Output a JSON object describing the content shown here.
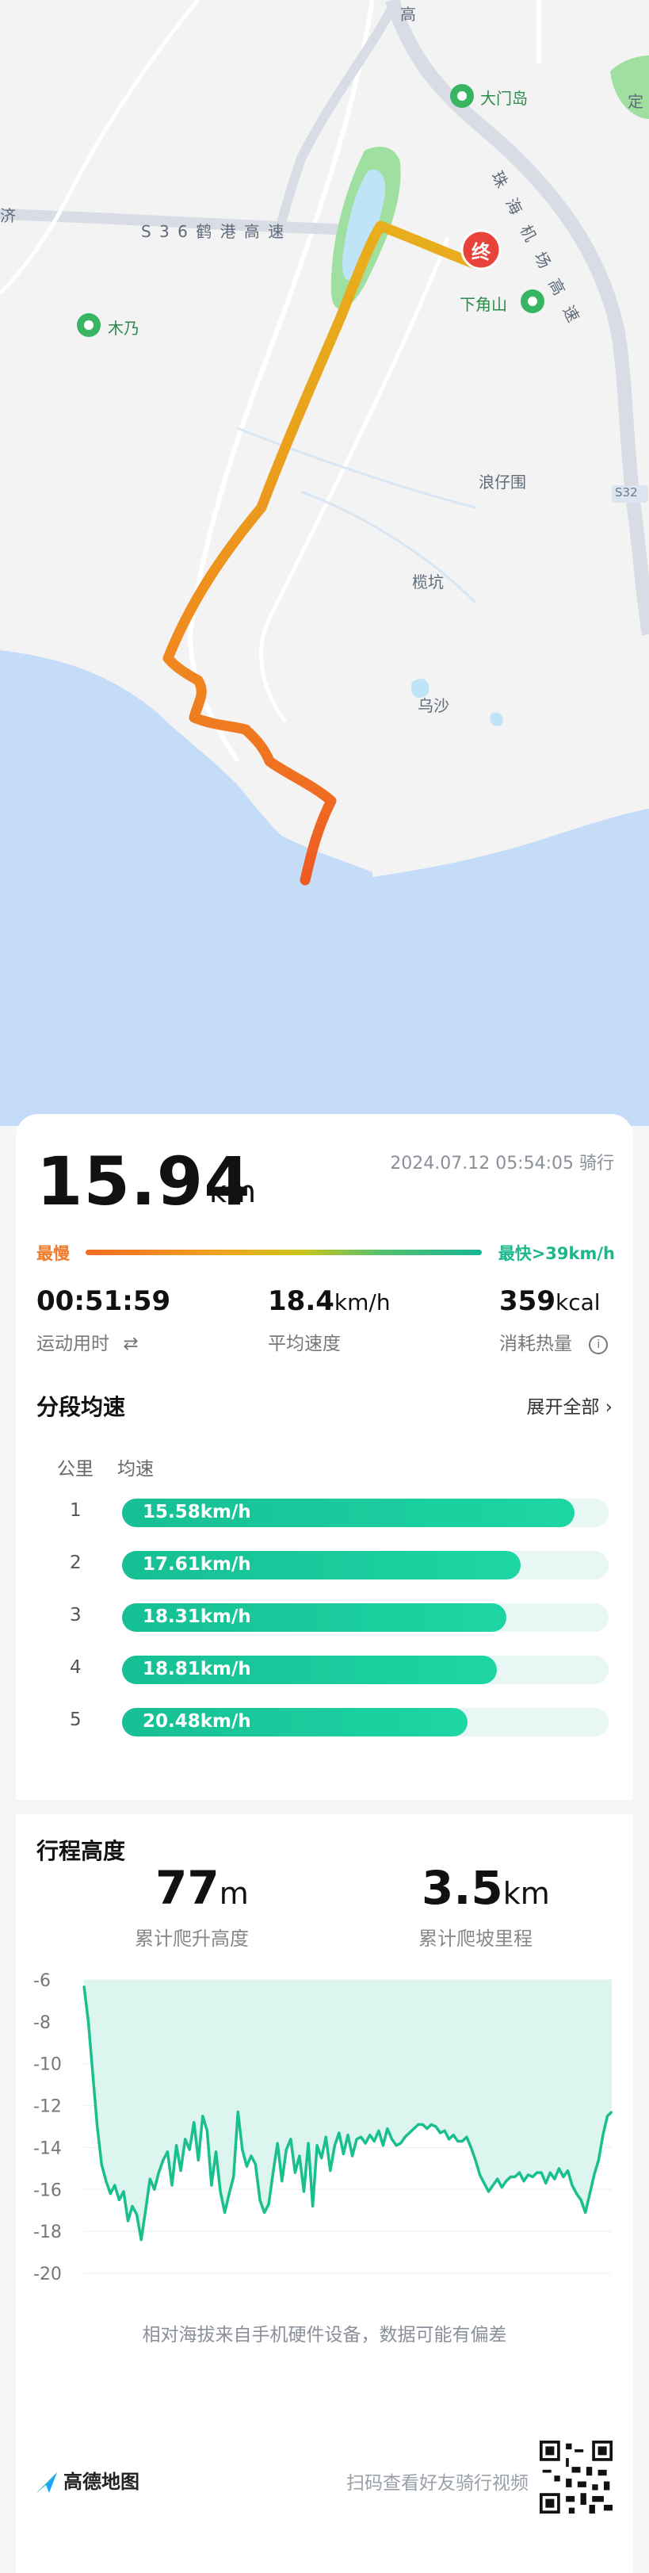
{
  "map": {
    "labels": {
      "damen_island": "大门岛",
      "ding": "定",
      "expressway_s36": "S 3 6 鹤 港 高 速",
      "airport_expressway": "珠 海 机 场 高 速",
      "gao": "高",
      "ji": "济",
      "munai": "木乃",
      "xiajiaoshan": "下角山",
      "langzaiwei": "浪仔围",
      "lankeng": "榄坑",
      "wusha": "乌沙",
      "road_code": "S32"
    },
    "end_marker": "终"
  },
  "summary": {
    "distance": "15.94",
    "distance_unit": "km",
    "datetime_activity": "2024.07.12 05:54:05 骑行",
    "slowest_label": "最慢",
    "fastest_label": "最快>39km/h"
  },
  "stats": {
    "duration": {
      "value": "00:51:59",
      "label": "运动用时"
    },
    "avg_speed": {
      "value": "18.4",
      "unit": "km/h",
      "label": "平均速度"
    },
    "calories": {
      "value": "359",
      "unit": "kcal",
      "label": "消耗热量"
    }
  },
  "segments": {
    "title": "分段均速",
    "expand_label": "展开全部",
    "col_km": "公里",
    "col_speed": "均速",
    "rows": [
      {
        "km": "1",
        "speed": "15.58km/h",
        "ratio": 0.93
      },
      {
        "km": "2",
        "speed": "17.61km/h",
        "ratio": 0.82
      },
      {
        "km": "3",
        "speed": "18.31km/h",
        "ratio": 0.79
      },
      {
        "km": "4",
        "speed": "18.81km/h",
        "ratio": 0.77
      },
      {
        "km": "5",
        "speed": "20.48km/h",
        "ratio": 0.71
      }
    ]
  },
  "elevation": {
    "title": "行程高度",
    "climb_value": "77",
    "climb_unit": "m",
    "climb_label": "累计爬升高度",
    "climb_dist_value": "3.5",
    "climb_dist_unit": "km",
    "climb_dist_label": "累计爬坡里程",
    "note": "相对海拔来自手机硬件设备，数据可能有偏差"
  },
  "chart_data": {
    "type": "area",
    "xlabel": "",
    "ylabel": "",
    "ylim": [
      -20,
      -6
    ],
    "yticks": [
      "-6",
      "-8",
      "-10",
      "-12",
      "-14",
      "-16",
      "-18",
      "-20"
    ],
    "series": [
      {
        "values": [
          -6.3,
          -8,
          -10.5,
          -13,
          -14.8,
          -15.6,
          -16.2,
          -15.8,
          -16.5,
          -16.1,
          -17.5,
          -16.8,
          -17.2,
          -18.4,
          -17,
          -15.5,
          -16,
          -15.2,
          -14.6,
          -14.2,
          -15.8,
          -13.9,
          -15.1,
          -13.6,
          -14.1,
          -12.8,
          -14.6,
          -12.5,
          -13.2,
          -15.8,
          -14.2,
          -16.1,
          -17.1,
          -16.2,
          -15.4,
          -12.3,
          -14.1,
          -14.9,
          -14.4,
          -14.8,
          -16.5,
          -17.1,
          -16.7,
          -15.2,
          -13.8,
          -15.6,
          -14.1,
          -13.6,
          -15.2,
          -14.4,
          -16.1,
          -13.8,
          -16.8,
          -13.9,
          -14.5,
          -13.5,
          -15.1,
          -13.9,
          -13.3,
          -14.3,
          -13.4,
          -14.4,
          -13.6,
          -13.5,
          -13.8,
          -13.4,
          -13.7,
          -13.2,
          -13.9,
          -13.1,
          -13.6,
          -13.9,
          -13.8,
          -13.5,
          -13.3,
          -13.1,
          -12.9,
          -12.9,
          -13.1,
          -12.9,
          -13,
          -13.3,
          -13.2,
          -13.6,
          -13.4,
          -13.7,
          -13.7,
          -13.5,
          -14,
          -14.6,
          -15.3,
          -15.7,
          -16.1,
          -15.8,
          -15.5,
          -15.9,
          -15.6,
          -15.4,
          -15.4,
          -15.2,
          -15.6,
          -15.3,
          -15.4,
          -15.2,
          -15.2,
          -15.7,
          -15.2,
          -15.5,
          -15,
          -15.4,
          -15.1,
          -15.8,
          -16.2,
          -16.5,
          -17.1,
          -16.2,
          -15.3,
          -14.6,
          -13.4,
          -12.5,
          -12.3
        ]
      }
    ]
  },
  "footer": {
    "brand": "高德地图",
    "scan_text": "扫码查看好友骑行视频"
  }
}
